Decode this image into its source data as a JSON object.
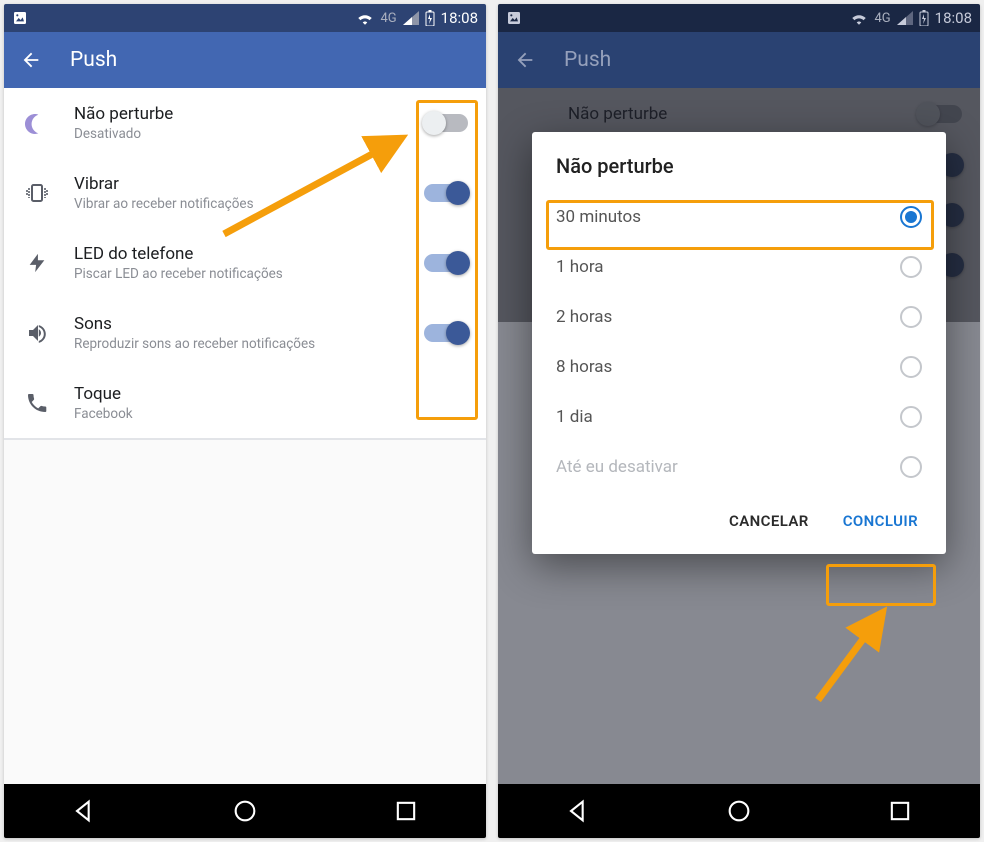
{
  "status": {
    "signal": "4G",
    "time": "18:08"
  },
  "header": {
    "title": "Push"
  },
  "settings": [
    {
      "key": "dnd",
      "icon": "moon-icon",
      "title": "Não perturbe",
      "sub": "Desativado",
      "toggle": false
    },
    {
      "key": "vibrate",
      "icon": "vibrate-icon",
      "title": "Vibrar",
      "sub": "Vibrar ao receber notificações",
      "toggle": true
    },
    {
      "key": "led",
      "icon": "bolt-icon",
      "title": "LED do telefone",
      "sub": "Piscar LED ao receber notificações",
      "toggle": true
    },
    {
      "key": "sounds",
      "icon": "speaker-icon",
      "title": "Sons",
      "sub": "Reproduzir sons ao receber notificações",
      "toggle": true
    },
    {
      "key": "ringtone",
      "icon": "phone-icon",
      "title": "Toque",
      "sub": "Facebook",
      "toggle": null
    }
  ],
  "dialog": {
    "title": "Não perturbe",
    "options": [
      {
        "label": "30 minutos",
        "selected": true
      },
      {
        "label": "1 hora",
        "selected": false
      },
      {
        "label": "2 horas",
        "selected": false
      },
      {
        "label": "8 horas",
        "selected": false
      },
      {
        "label": "1 dia",
        "selected": false
      },
      {
        "label": "Até eu desativar",
        "selected": false,
        "disabled": true
      }
    ],
    "cancel": "CANCELAR",
    "confirm": "CONCLUIR"
  }
}
